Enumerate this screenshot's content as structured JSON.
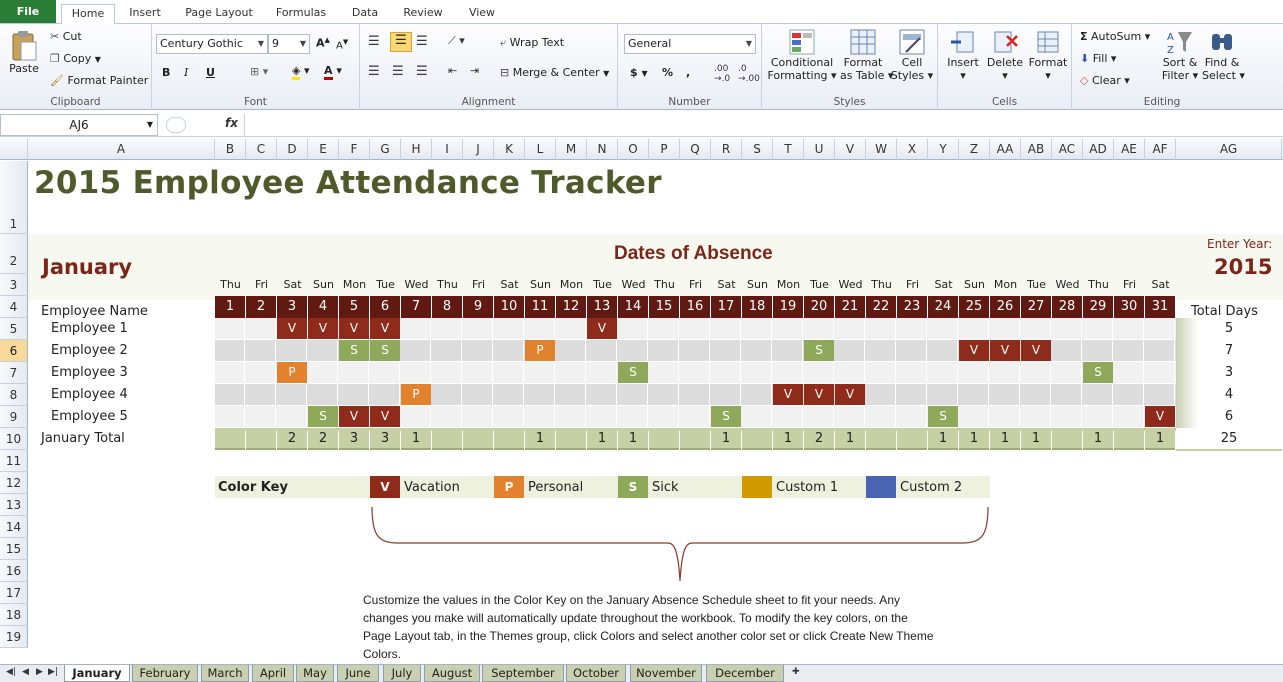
{
  "ribbon_tabs": {
    "file": "File",
    "tabs": [
      "Home",
      "Insert",
      "Page Layout",
      "Formulas",
      "Data",
      "Review",
      "View"
    ]
  },
  "clipboard": {
    "paste": "Paste",
    "cut": "Cut",
    "copy": "Copy",
    "format_painter": "Format Painter",
    "label": "Clipboard"
  },
  "font": {
    "name": "Century Gothic",
    "size": "9",
    "bold": "B",
    "italic": "I",
    "underline": "U",
    "label": "Font"
  },
  "alignment": {
    "wrap_text": "Wrap Text",
    "merge_center": "Merge & Center",
    "label": "Alignment"
  },
  "number": {
    "format": "General",
    "currency": "$",
    "percent": "%",
    "comma": ",",
    "label": "Number"
  },
  "styles": {
    "conditional_1": "Conditional",
    "conditional_2": "Formatting",
    "format_table_1": "Format",
    "format_table_2": "as Table",
    "cell_styles_1": "Cell",
    "cell_styles_2": "Styles",
    "label": "Styles"
  },
  "cells": {
    "insert": "Insert",
    "delete": "Delete",
    "format": "Format",
    "label": "Cells"
  },
  "editing": {
    "autosum": "AutoSum",
    "fill": "Fill",
    "clear": "Clear",
    "sort_1": "Sort &",
    "sort_2": "Filter",
    "find_1": "Find &",
    "find_2": "Select",
    "label": "Editing"
  },
  "formula_bar": {
    "name_box": "AJ6",
    "fx": "fx",
    "formula": ""
  },
  "columns": [
    "A",
    "B",
    "C",
    "D",
    "E",
    "F",
    "G",
    "H",
    "I",
    "J",
    "K",
    "L",
    "M",
    "N",
    "O",
    "P",
    "Q",
    "R",
    "S",
    "T",
    "U",
    "V",
    "W",
    "X",
    "Y",
    "Z",
    "AA",
    "AB",
    "AC",
    "AD",
    "AE",
    "AF",
    "AG"
  ],
  "rows": [
    "1",
    "2",
    "3",
    "4",
    "5",
    "6",
    "7",
    "8",
    "9",
    "10",
    "11",
    "12",
    "13",
    "14",
    "15",
    "16",
    "17",
    "18",
    "19"
  ],
  "sheet": {
    "title": "2015 Employee Attendance Tracker",
    "month": "January",
    "subtitle": "Dates of Absence",
    "enter_year_label": "Enter Year:",
    "year": "2015",
    "employee_header": "Employee Name",
    "total_header": "Total Days",
    "days_of_week": [
      "Thu",
      "Fri",
      "Sat",
      "Sun",
      "Mon",
      "Tue",
      "Wed",
      "Thu",
      "Fri",
      "Sat",
      "Sun",
      "Mon",
      "Tue",
      "Wed",
      "Thu",
      "Fri",
      "Sat",
      "Sun",
      "Mon",
      "Tue",
      "Wed",
      "Thu",
      "Fri",
      "Sat",
      "Sun",
      "Mon",
      "Tue",
      "Wed",
      "Thu",
      "Fri",
      "Sat"
    ],
    "days": [
      "1",
      "2",
      "3",
      "4",
      "5",
      "6",
      "7",
      "8",
      "9",
      "10",
      "11",
      "12",
      "13",
      "14",
      "15",
      "16",
      "17",
      "18",
      "19",
      "20",
      "21",
      "22",
      "23",
      "24",
      "25",
      "26",
      "27",
      "28",
      "29",
      "30",
      "31"
    ],
    "employees": [
      {
        "name": "Employee 1",
        "total": "5",
        "absences": {
          "3": "V",
          "4": "V",
          "5": "V",
          "6": "V",
          "13": "V"
        }
      },
      {
        "name": "Employee 2",
        "total": "7",
        "absences": {
          "5": "S",
          "6": "S",
          "11": "P",
          "20": "S",
          "25": "V",
          "26": "V",
          "27": "V"
        }
      },
      {
        "name": "Employee 3",
        "total": "3",
        "absences": {
          "3": "P",
          "14": "S",
          "29": "S"
        }
      },
      {
        "name": "Employee 4",
        "total": "4",
        "absences": {
          "7": "P",
          "19": "V",
          "20": "V",
          "21": "V"
        }
      },
      {
        "name": "Employee 5",
        "total": "6",
        "absences": {
          "4": "S",
          "5": "V",
          "6": "V",
          "17": "S",
          "24": "S",
          "31": "V"
        }
      }
    ],
    "total_row": {
      "label": "January Total",
      "values": {
        "3": "2",
        "4": "2",
        "5": "3",
        "6": "3",
        "7": "1",
        "11": "1",
        "13": "1",
        "14": "1",
        "17": "1",
        "19": "1",
        "20": "2",
        "21": "1",
        "24": "1",
        "25": "1",
        "26": "1",
        "27": "1",
        "29": "1",
        "31": "1"
      },
      "total": "25"
    },
    "color_key": {
      "label": "Color Key",
      "items": [
        {
          "code": "V",
          "name": "Vacation",
          "color": "#8e2b1b"
        },
        {
          "code": "P",
          "name": "Personal",
          "color": "#e2822f"
        },
        {
          "code": "S",
          "name": "Sick",
          "color": "#8ea95a"
        },
        {
          "code": "",
          "name": "Custom 1",
          "color": "#d09a00"
        },
        {
          "code": "",
          "name": "Custom 2",
          "color": "#4a64b4"
        }
      ]
    },
    "note": [
      "Customize the values in the Color Key on the January Absence Schedule sheet to fit your needs. Any",
      "changes you make will automatically update throughout the workbook.  To modify the key colors, on the",
      "Page Layout tab,  in the Themes group, click Colors and select another color set or click Create New Theme",
      "Colors."
    ]
  },
  "sheet_tabs": [
    "January",
    "February",
    "March",
    "April",
    "May",
    "June",
    "July",
    "August",
    "September",
    "October",
    "November",
    "December"
  ],
  "colors": {
    "title": "#4f5a2a",
    "month": "#7b2618",
    "day_header": "#611a11",
    "vacation": "#8e2b1b",
    "personal": "#e2822f",
    "sick": "#8ea95a",
    "total_row": "#c5d0a5"
  }
}
